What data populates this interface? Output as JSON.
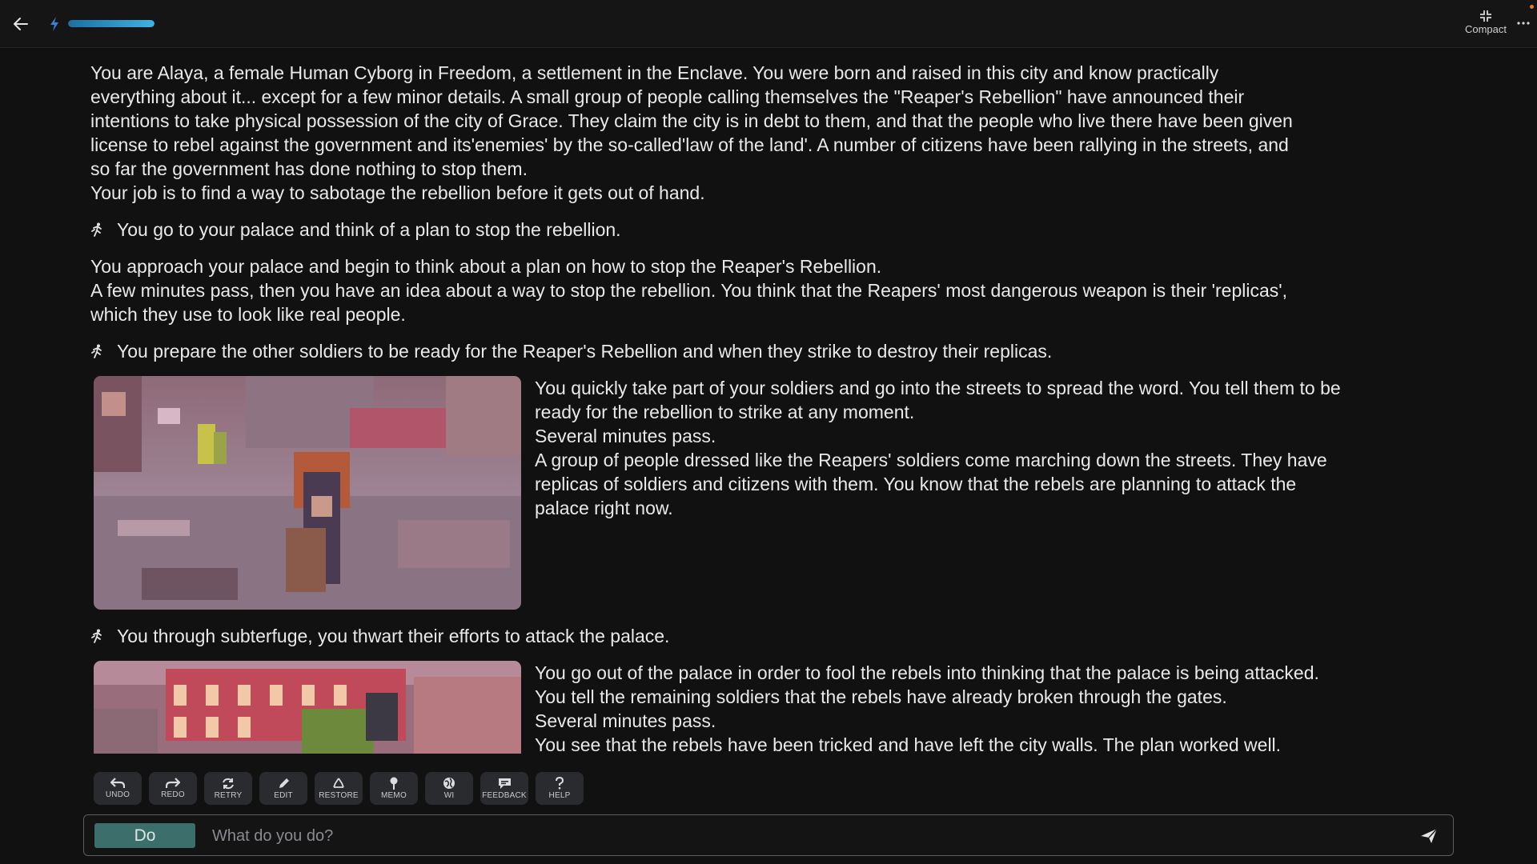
{
  "header": {
    "energy_fraction": 1.0,
    "compact_label": "Compact",
    "icons": [
      "arrow-left-icon",
      "bolt-icon",
      "compact-icon",
      "more-icon"
    ],
    "accent_color": "#3fb1e3"
  },
  "story": {
    "intro_lines": [
      "You are Alaya, a female Human Cyborg in Freedom, a settlement in the Enclave. You were born and raised in this city and know practically",
      "everything about it... except for a few minor details. A small group of people calling themselves the \"Reaper's Rebellion\" have announced their",
      "intentions to take physical possession of the city of Grace. They claim the city is in debt to them, and that the people who live there have been given",
      "license to rebel against the government and its'enemies' by the so-called'law of the land'. A number of citizens have been rallying in the streets, and",
      "so far the government has done nothing to stop them.",
      "Your job is to find a way to sabotage the rebellion before it gets out of hand."
    ],
    "action_1": "You go to your palace and think of a plan to stop the rebellion.",
    "response_1_lines": [
      "You approach your palace and begin to think about a plan on how to stop the Reaper's Rebellion.",
      "A few minutes pass, then you have an idea about a way to stop the rebellion. You think that the Reapers' most dangerous weapon is their 'replicas',",
      "which they use to look like real people."
    ],
    "action_2": "You prepare the other soldiers to be ready for the Reaper's Rebellion and when they strike to destroy their replicas.",
    "response_2_lines": [
      "You quickly take part of your soldiers and go into the streets to spread the word. You tell them to be",
      "ready for the rebellion to strike at any moment.",
      "Several minutes pass.",
      "A group of people dressed like the Reapers' soldiers come marching down the streets. They have",
      "replicas of soldiers and citizens with them. You know that the rebels are planning to attack the",
      "palace right now."
    ],
    "action_3": "You through subterfuge, you thwart their efforts to attack the palace.",
    "response_3_lines": [
      "You go out of the palace in order to fool the rebels into thinking that the palace is being attacked.",
      "You tell the remaining soldiers that the rebels have already broken through the gates.",
      "Several minutes pass.",
      "You see that the rebels have been tricked and have left the city walls. The plan worked well."
    ]
  },
  "toolbar": {
    "undo": "UNDO",
    "redo": "REDO",
    "retry": "RETRY",
    "edit": "EDIT",
    "restore": "RESTORE",
    "memo": "MEMO",
    "wi": "WI",
    "feedback": "FEEDBACK",
    "help": "HELP"
  },
  "input": {
    "mode_label": "Do",
    "placeholder": "What do you do?",
    "value": ""
  }
}
